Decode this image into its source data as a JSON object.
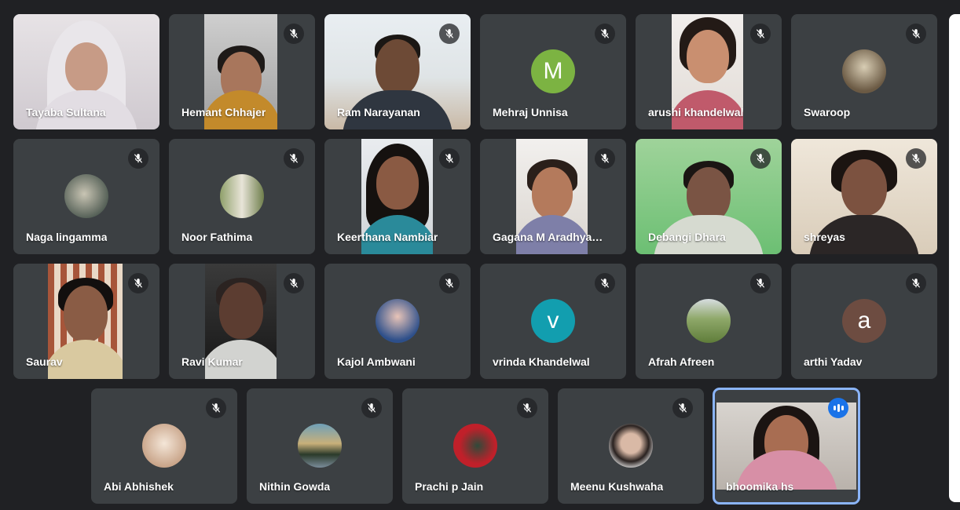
{
  "participants": [
    {
      "name": "Tayaba Sultana",
      "type": "video",
      "muted": false
    },
    {
      "name": "Hemant Chhajer",
      "type": "video",
      "muted": true
    },
    {
      "name": "Ram Narayanan",
      "type": "video",
      "muted": true
    },
    {
      "name": "Mehraj Unnisa",
      "type": "initial",
      "initial": "M",
      "color": "#7cb342",
      "muted": true
    },
    {
      "name": "arushi khandelwal",
      "type": "video",
      "muted": true
    },
    {
      "name": "Swaroop",
      "type": "photo",
      "muted": true
    },
    {
      "name": "Naga lingamma",
      "type": "photo",
      "muted": true
    },
    {
      "name": "Noor Fathima",
      "type": "photo",
      "muted": true
    },
    {
      "name": "Keerthana Nambiar",
      "type": "video",
      "muted": true
    },
    {
      "name": "Gagana M Aradhya…",
      "type": "video",
      "muted": true
    },
    {
      "name": "Debangi Dhara",
      "type": "video",
      "muted": true
    },
    {
      "name": "shreyas",
      "type": "video",
      "muted": true
    },
    {
      "name": "Saurav",
      "type": "video",
      "muted": true
    },
    {
      "name": "Ravi Kumar",
      "type": "video",
      "muted": true
    },
    {
      "name": "Kajol Ambwani",
      "type": "photo",
      "muted": true
    },
    {
      "name": "vrinda Khandelwal",
      "type": "initial",
      "initial": "v",
      "color": "#129eaf",
      "muted": true
    },
    {
      "name": "Afrah Afreen",
      "type": "photo",
      "muted": true
    },
    {
      "name": "arthi Yadav",
      "type": "initial",
      "initial": "a",
      "color": "#6d4c41",
      "muted": true
    },
    {
      "name": "Abi Abhishek",
      "type": "photo",
      "muted": true
    },
    {
      "name": "Nithin Gowda",
      "type": "photo",
      "muted": true
    },
    {
      "name": "Prachi p Jain",
      "type": "photo",
      "muted": true
    },
    {
      "name": "Meenu Kushwaha",
      "type": "photo",
      "muted": true
    },
    {
      "name": "bhoomika hs",
      "type": "video",
      "muted": false,
      "speaking": true
    }
  ],
  "icons": {
    "muted": "mic-off-icon",
    "speaking": "audio-level-icon"
  },
  "colors": {
    "background": "#202124",
    "tile": "#3c4043",
    "speaking_outline": "#8ab4f8",
    "speaking_badge": "#1a73e8"
  }
}
